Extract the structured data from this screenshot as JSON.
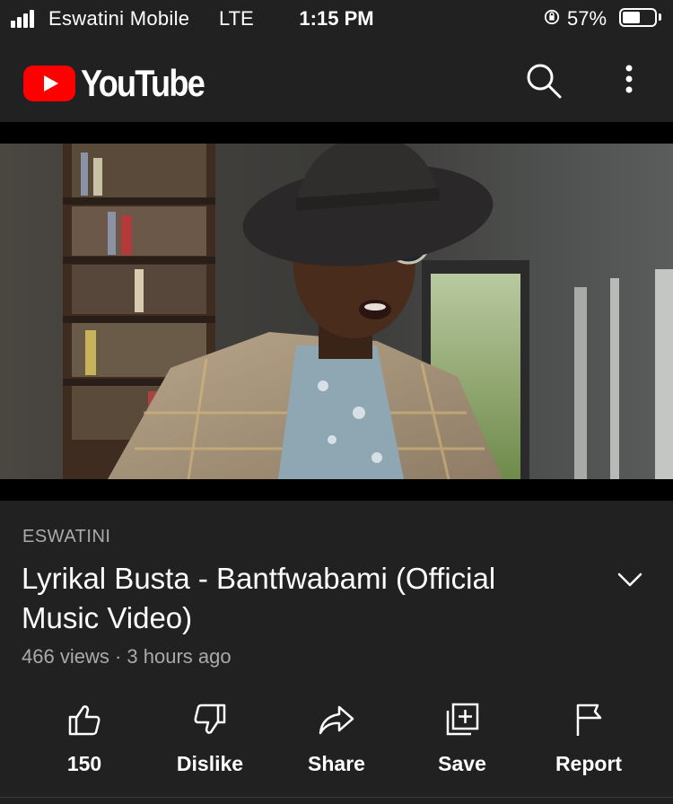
{
  "status_bar": {
    "carrier": "Eswatini Mobile",
    "network": "LTE",
    "time": "1:15 PM",
    "battery_percent": "57%",
    "battery_level": 0.57,
    "icons": [
      "signal-icon",
      "orientation-lock-icon",
      "battery-icon"
    ]
  },
  "header": {
    "logo_text": "YouTube",
    "brand_color": "#FF0000",
    "icons": [
      "search-icon",
      "more-vert-icon"
    ]
  },
  "video": {
    "channel": "ESWATINI",
    "title": "Lyrikal Busta - Bantfwabami (Official Music Video)",
    "views": "466 views",
    "separator": "·",
    "time_ago": "3 hours ago"
  },
  "actions": {
    "like": "150",
    "dislike": "Dislike",
    "share": "Share",
    "save": "Save",
    "report": "Report"
  },
  "colors": {
    "background": "#212121",
    "secondary_text": "#AAAAAA",
    "primary_text": "#FFFFFF"
  }
}
